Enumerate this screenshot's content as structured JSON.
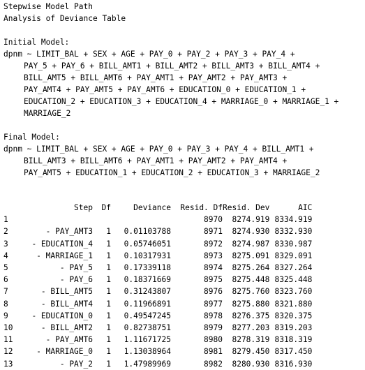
{
  "header": {
    "title": "Stepwise Model Path",
    "subtitle": "Analysis of Deviance Table"
  },
  "initial": {
    "label": "Initial Model:",
    "lines": [
      "dpnm ~ LIMIT_BAL + SEX + AGE + PAY_0 + PAY_2 + PAY_3 + PAY_4 +",
      "PAY_5 + PAY_6 + BILL_AMT1 + BILL_AMT2 + BILL_AMT3 + BILL_AMT4 +",
      "BILL_AMT5 + BILL_AMT6 + PAY_AMT1 + PAY_AMT2 + PAY_AMT3 +",
      "PAY_AMT4 + PAY_AMT5 + PAY_AMT6 + EDUCATION_0 + EDUCATION_1 +",
      "EDUCATION_2 + EDUCATION_3 + EDUCATION_4 + MARRIAGE_0 + MARRIAGE_1 +",
      "MARRIAGE_2"
    ]
  },
  "final": {
    "label": "Final Model:",
    "lines": [
      "dpnm ~ LIMIT_BAL + SEX + AGE + PAY_0 + PAY_3 + PAY_4 + BILL_AMT1 +",
      "BILL_AMT3 + BILL_AMT6 + PAY_AMT1 + PAY_AMT2 + PAY_AMT4 +",
      "PAY_AMT5 + EDUCATION_1 + EDUCATION_2 + EDUCATION_3 + MARRIAGE_2"
    ]
  },
  "table": {
    "headers": [
      "",
      "Step",
      "Df",
      "Deviance",
      "Resid. Df",
      "Resid. Dev",
      "AIC"
    ],
    "rows": [
      [
        "1",
        "",
        "",
        "",
        "8970",
        "8274.919",
        "8334.919"
      ],
      [
        "2",
        "- PAY_AMT3",
        "1",
        "0.01103788",
        "8971",
        "8274.930",
        "8332.930"
      ],
      [
        "3",
        "- EDUCATION_4",
        "1",
        "0.05746051",
        "8972",
        "8274.987",
        "8330.987"
      ],
      [
        "4",
        "- MARRIAGE_1",
        "1",
        "0.10317931",
        "8973",
        "8275.091",
        "8329.091"
      ],
      [
        "5",
        "- PAY_5",
        "1",
        "0.17339118",
        "8974",
        "8275.264",
        "8327.264"
      ],
      [
        "6",
        "- PAY_6",
        "1",
        "0.18371669",
        "8975",
        "8275.448",
        "8325.448"
      ],
      [
        "7",
        "- BILL_AMT5",
        "1",
        "0.31243807",
        "8976",
        "8275.760",
        "8323.760"
      ],
      [
        "8",
        "- BILL_AMT4",
        "1",
        "0.11966891",
        "8977",
        "8275.880",
        "8321.880"
      ],
      [
        "9",
        "- EDUCATION_0",
        "1",
        "0.49547245",
        "8978",
        "8276.375",
        "8320.375"
      ],
      [
        "10",
        "- BILL_AMT2",
        "1",
        "0.82738751",
        "8979",
        "8277.203",
        "8319.203"
      ],
      [
        "11",
        "- PAY_AMT6",
        "1",
        "1.11671725",
        "8980",
        "8278.319",
        "8318.319"
      ],
      [
        "12",
        "- MARRIAGE_0",
        "1",
        "1.13038964",
        "8981",
        "8279.450",
        "8317.450"
      ],
      [
        "13",
        "- PAY_2",
        "1",
        "1.47989969",
        "8982",
        "8280.930",
        "8316.930"
      ]
    ]
  }
}
